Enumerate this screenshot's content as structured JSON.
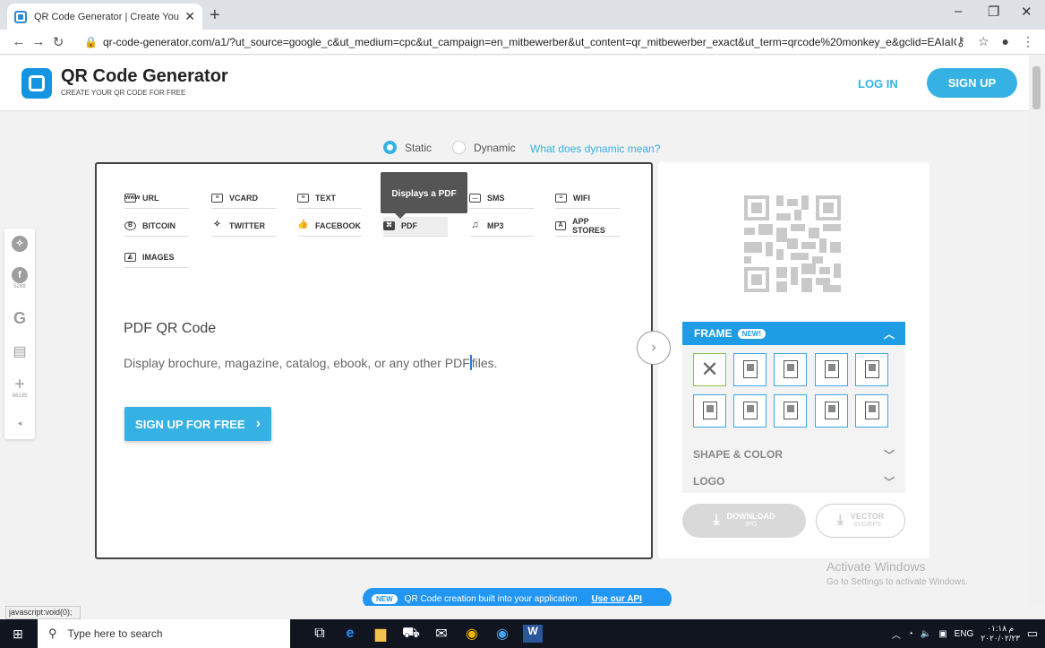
{
  "browser": {
    "tab_title": "QR Code Generator | Create Your",
    "url": "qr-code-generator.com/a1/?ut_source=google_c&ut_medium=cpc&ut_campaign=en_mitbewerber&ut_content=qr_mitbewerber_exact&ut_term=qrcode%20monkey_e&gclid=EAIaIQo..."
  },
  "header": {
    "brand": "QR Code Generator",
    "tagline": "CREATE YOUR QR CODE FOR FREE",
    "login": "LOG IN",
    "signup": "SIGN UP"
  },
  "mode": {
    "static": "Static",
    "dynamic": "Dynamic",
    "what_dynamic": "What does dynamic mean?"
  },
  "types": [
    {
      "label": "URL",
      "icon": "url-icon"
    },
    {
      "label": "VCARD",
      "icon": "vcard-icon"
    },
    {
      "label": "TEXT",
      "icon": "text-icon"
    },
    {
      "label": "SMS",
      "icon": "sms-icon"
    },
    {
      "label": "WIFI",
      "icon": "wifi-icon"
    },
    {
      "label": "BITCOIN",
      "icon": "bitcoin-icon"
    },
    {
      "label": "TWITTER",
      "icon": "twitter-icon"
    },
    {
      "label": "FACEBOOK",
      "icon": "facebook-icon"
    },
    {
      "label": "PDF",
      "icon": "pdf-icon"
    },
    {
      "label": "MP3",
      "icon": "mp3-icon"
    },
    {
      "label": "APP STORES",
      "icon": "app-stores-icon"
    },
    {
      "label": "IMAGES",
      "icon": "images-icon"
    }
  ],
  "tooltip": "Displays a PDF",
  "content": {
    "title": "PDF QR Code",
    "desc_before": "Display brochure, magazine, catalog, ebook, or any other PDF",
    "desc_after": "files.",
    "cta": "SIGN UP FOR FREE"
  },
  "side": {
    "frame": "FRAME",
    "frame_badge": "NEW!",
    "shape_color": "SHAPE & COLOR",
    "logo": "LOGO",
    "download": "DOWNLOAD",
    "download_sub": "JPG",
    "vector": "VECTOR",
    "vector_sub": "SVG/EPS"
  },
  "social": {
    "facebook_count": "5288",
    "share_count": "66135"
  },
  "api_bar": {
    "badge": "NEW",
    "text": "QR Code creation built into your application",
    "link": "Use our API"
  },
  "activate": {
    "title": "Activate Windows",
    "sub": "Go to Settings to activate Windows."
  },
  "status": "javascript:void(0);",
  "taskbar": {
    "search_placeholder": "Type here to search",
    "lang": "ENG",
    "time": "۰۱:۱۸ م",
    "date": "۲۰۲۰/۰۲/۲۳"
  },
  "colors": {
    "accent": "#35b2e3",
    "frame_header": "#1e9de4",
    "api_bar": "#2196f3"
  }
}
